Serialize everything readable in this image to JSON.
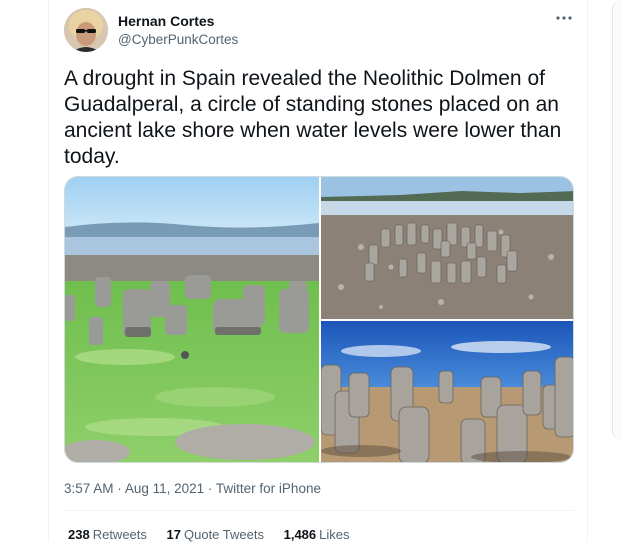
{
  "tweet": {
    "author_name": "Hernan Cortes",
    "author_handle": "@CyberPunkCortes",
    "more_icon": "more-horizontal-icon",
    "text": "A drought in Spain revealed the Neolithic Dolmen of Guadalperal, a circle of standing stones placed on an ancient lake shore when water levels were lower than today.",
    "time": "3:57 AM",
    "date": "Aug 11, 2021",
    "source": "Twitter for iPhone",
    "separator": "·"
  },
  "stats": {
    "retweets_count": "238",
    "retweets_label": "Retweets",
    "quotes_count": "17",
    "quotes_label": "Quote Tweets",
    "likes_count": "1,486",
    "likes_label": "Likes"
  },
  "colors": {
    "text_primary": "#0f1419",
    "text_secondary": "#536471",
    "border": "#eff3f4"
  }
}
